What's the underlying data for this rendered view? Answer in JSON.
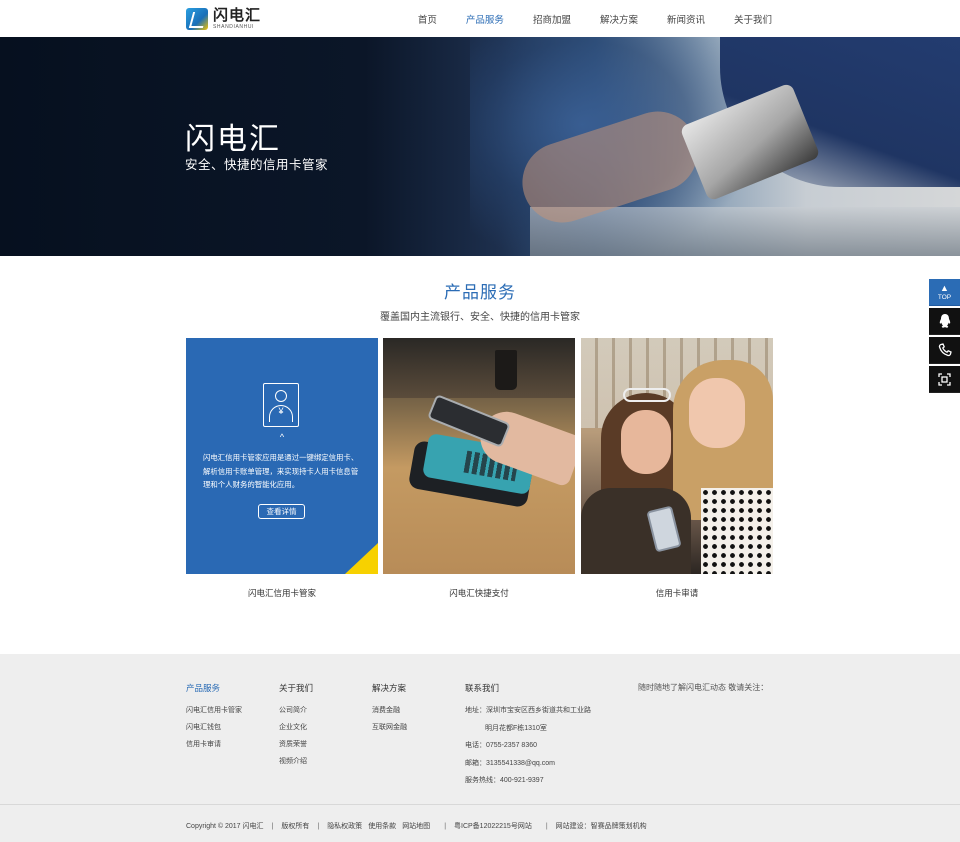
{
  "header": {
    "logo_cn": "闪电汇",
    "logo_en": "SHANDIANHUI",
    "nav": [
      {
        "label": "首页",
        "active": false
      },
      {
        "label": "产品服务",
        "active": true
      },
      {
        "label": "招商加盟",
        "active": false
      },
      {
        "label": "解决方案",
        "active": false
      },
      {
        "label": "新闻资讯",
        "active": false
      },
      {
        "label": "关于我们",
        "active": false
      }
    ]
  },
  "banner": {
    "title": "闪电汇",
    "subtitle": "安全、快捷的信用卡管家"
  },
  "section": {
    "title": "产品服务",
    "subtitle": "覆盖国内主流银行、安全、快捷的信用卡管家"
  },
  "cards": [
    {
      "caption": "闪电汇信用卡管家",
      "description": "闪电汇信用卡管家应用是通过一键绑定信用卡、解析信用卡账单管理，来实现持卡人用卡信息管理和个人财务的智能化应用。",
      "button": "查看详情",
      "chevron": "^"
    },
    {
      "caption": "闪电汇快捷支付"
    },
    {
      "caption": "信用卡审请"
    }
  ],
  "footer": {
    "columns": [
      {
        "heading": "产品服务",
        "links": [
          "闪电汇信用卡管家",
          "闪电汇钱包",
          "信用卡审请"
        ]
      },
      {
        "heading": "关于我们",
        "links": [
          "公司简介",
          "企业文化",
          "资质荣誉",
          "视频介绍"
        ]
      },
      {
        "heading": "解决方案",
        "links": [
          "消费金融",
          "互联网金融"
        ]
      }
    ],
    "contact": {
      "heading": "联系我们",
      "address_line1": "地址：深圳市宝安区西乡街道共和工业路",
      "address_line2": "明月花都F栋1310室",
      "phone": "电话：0755-2357 8360",
      "email": "邮箱：3135541338@qq.com",
      "hotline": "服务热线：400-921-9397"
    },
    "follow": "随时随地了解闪电汇动态 敬请关注：",
    "bottom": {
      "copyright": "Copyright © 2017 闪电汇",
      "rights": "版权所有",
      "privacy": "隐私权政策",
      "terms": "使用条款",
      "sitemap": "网站地图",
      "icp": "粤ICP备12022215号网站",
      "builder": "网站建设：智赛品牌策划机构"
    }
  },
  "side_float": {
    "top_label": "TOP",
    "top_arrow": "▲",
    "icons": [
      "qq-icon",
      "phone-icon",
      "qrcode-icon"
    ]
  },
  "colors": {
    "accent": "#2b6cb5",
    "card_blue": "#2a69b4",
    "card_corner": "#f7d100",
    "footer_bg": "#eeeeee",
    "side_dark": "#111111"
  }
}
